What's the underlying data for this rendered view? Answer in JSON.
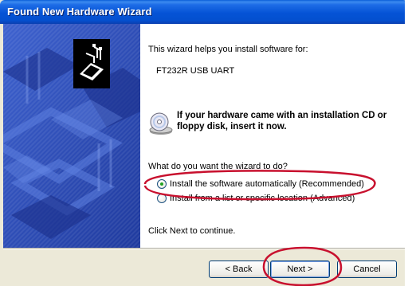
{
  "window": {
    "title": "Found New Hardware Wizard"
  },
  "wizard": {
    "intro": "This wizard helps you install software for:",
    "device_name": "FT232R USB UART",
    "cd_message": "If your hardware came with an installation CD or floppy disk, insert it now.",
    "question": "What do you want the wizard to do?",
    "options": [
      {
        "label": "Install the software automatically (Recommended)",
        "selected": true
      },
      {
        "label": "Install from a list or specific location (Advanced)",
        "selected": false
      }
    ],
    "footer_text": "Click Next to continue."
  },
  "buttons": {
    "back": "< Back",
    "next": "Next >",
    "cancel": "Cancel"
  },
  "icons": {
    "hardware": "hardware-board-icon",
    "cd": "cd-disk-icon"
  },
  "colors": {
    "titlebar": "#0553D6",
    "banner": "#2F4DBF",
    "annotation": "#C8102E",
    "radio_selected": "#21A121"
  }
}
